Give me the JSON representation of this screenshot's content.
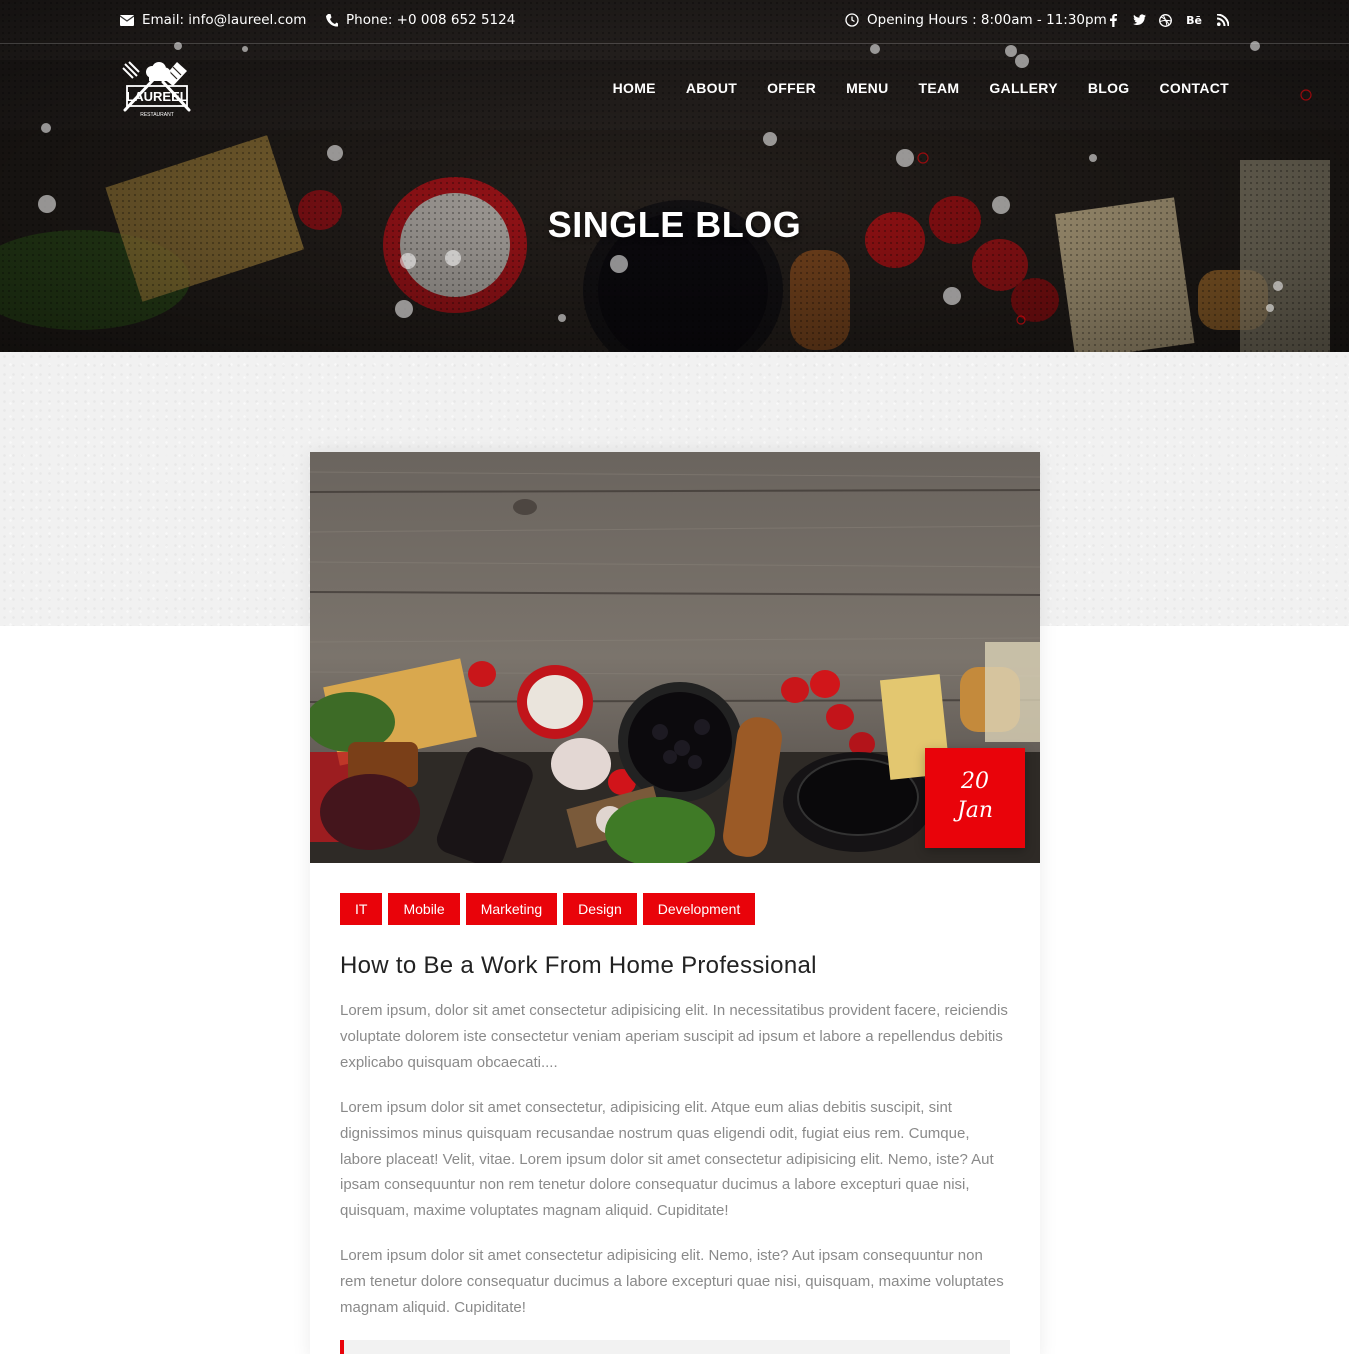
{
  "topbar": {
    "email": "Email: info@laureel.com",
    "phone": "Phone: +0 008 652 5124",
    "hours": "Opening Hours : 8:00am - 11:30pm",
    "social_icons": [
      "facebook-icon",
      "twitter-icon",
      "dribbble-icon",
      "behance-icon",
      "rss-icon"
    ],
    "behance_text": "Bē"
  },
  "brand": {
    "logo_text": "LAUREEL",
    "logo_subtext": "RESTAURANT"
  },
  "nav": {
    "items": [
      "HOME",
      "ABOUT",
      "OFFER",
      "MENU",
      "TEAM",
      "GALLERY",
      "BLOG",
      "CONTACT"
    ]
  },
  "hero": {
    "title": "SINGLE BLOG"
  },
  "post": {
    "date_day": "20",
    "date_month": "Jan",
    "tags": [
      "IT",
      "Mobile",
      "Marketing",
      "Design",
      "Development"
    ],
    "title": "How to Be a Work From Home Professional",
    "paragraphs": [
      "Lorem ipsum, dolor sit amet consectetur adipisicing elit. In necessitatibus provident facere, reiciendis voluptate dolorem iste consectetur veniam aperiam suscipit ad ipsum et labore a repellendus debitis explicabo quisquam obcaecati....",
      "Lorem ipsum dolor sit amet consectetur, adipisicing elit. Atque eum alias debitis suscipit, sint dignissimos minus quisquam recusandae nostrum quas eligendi odit, fugiat eius rem. Cumque, labore placeat! Velit, vitae. Lorem ipsum dolor sit amet consectetur adipisicing elit. Nemo, iste? Aut ipsam consequuntur non rem tenetur dolore consequatur ducimus a labore excepturi quae nisi, quisquam, maxime voluptates magnam aliquid. Cupiditate!",
      "Lorem ipsum dolor sit amet consectetur adipisicing elit. Nemo, iste? Aut ipsam consequuntur non rem tenetur dolore consequatur ducimus a labore excepturi quae nisi, quisquam, maxime voluptates magnam aliquid. Cupiditate!"
    ]
  },
  "colors": {
    "accent": "#e9030a",
    "hero_dark": "#1a1614",
    "body_text": "#8a8a8a",
    "heading_text": "#222222"
  }
}
